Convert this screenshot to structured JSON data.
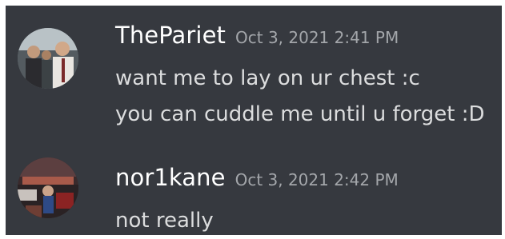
{
  "chat": {
    "messages": [
      {
        "username": "ThePariet",
        "timestamp": "Oct 3, 2021 2:41 PM",
        "lines": [
          "want me to lay on ur chest :c",
          "you can cuddle me until u forget :D"
        ],
        "avatar_icon": "user-avatar-photo"
      },
      {
        "username": "nor1kane",
        "timestamp": "Oct 3, 2021 2:42 PM",
        "lines": [
          "not really"
        ],
        "avatar_icon": "user-avatar-photo"
      }
    ]
  },
  "colors": {
    "background": "#36393f",
    "username": "#ffffff",
    "timestamp": "#a3a6aa",
    "message_text": "#dcddde"
  }
}
